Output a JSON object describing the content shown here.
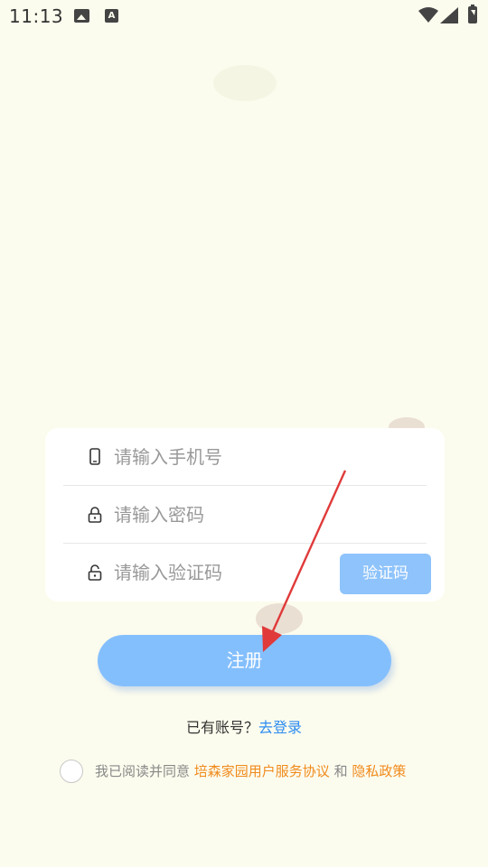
{
  "status_bar": {
    "time": "11:13",
    "icons": [
      "image-icon",
      "a-notification-icon",
      "wifi-icon",
      "signal-icon",
      "battery-charging-icon"
    ]
  },
  "form": {
    "phone_placeholder": "请输入手机号",
    "password_placeholder": "请输入密码",
    "code_placeholder": "请输入验证码",
    "code_button_label": "验证码",
    "icons": [
      "phone-icon",
      "lock-icon",
      "unlock-icon"
    ]
  },
  "register_button_label": "注册",
  "login_prompt": {
    "text": "已有账号？",
    "link": "去登录"
  },
  "agreement": {
    "prefix": "我已阅读并同意",
    "terms_link": "培森家园用户服务协议",
    "conjunction": "和",
    "privacy_link": "隐私政策"
  },
  "colors": {
    "background": "#fcfcee",
    "primary_button": "#84bffd",
    "link_blue": "#2d8cf0",
    "link_orange": "#f08a1c",
    "annotation_arrow": "#e03a3a"
  }
}
